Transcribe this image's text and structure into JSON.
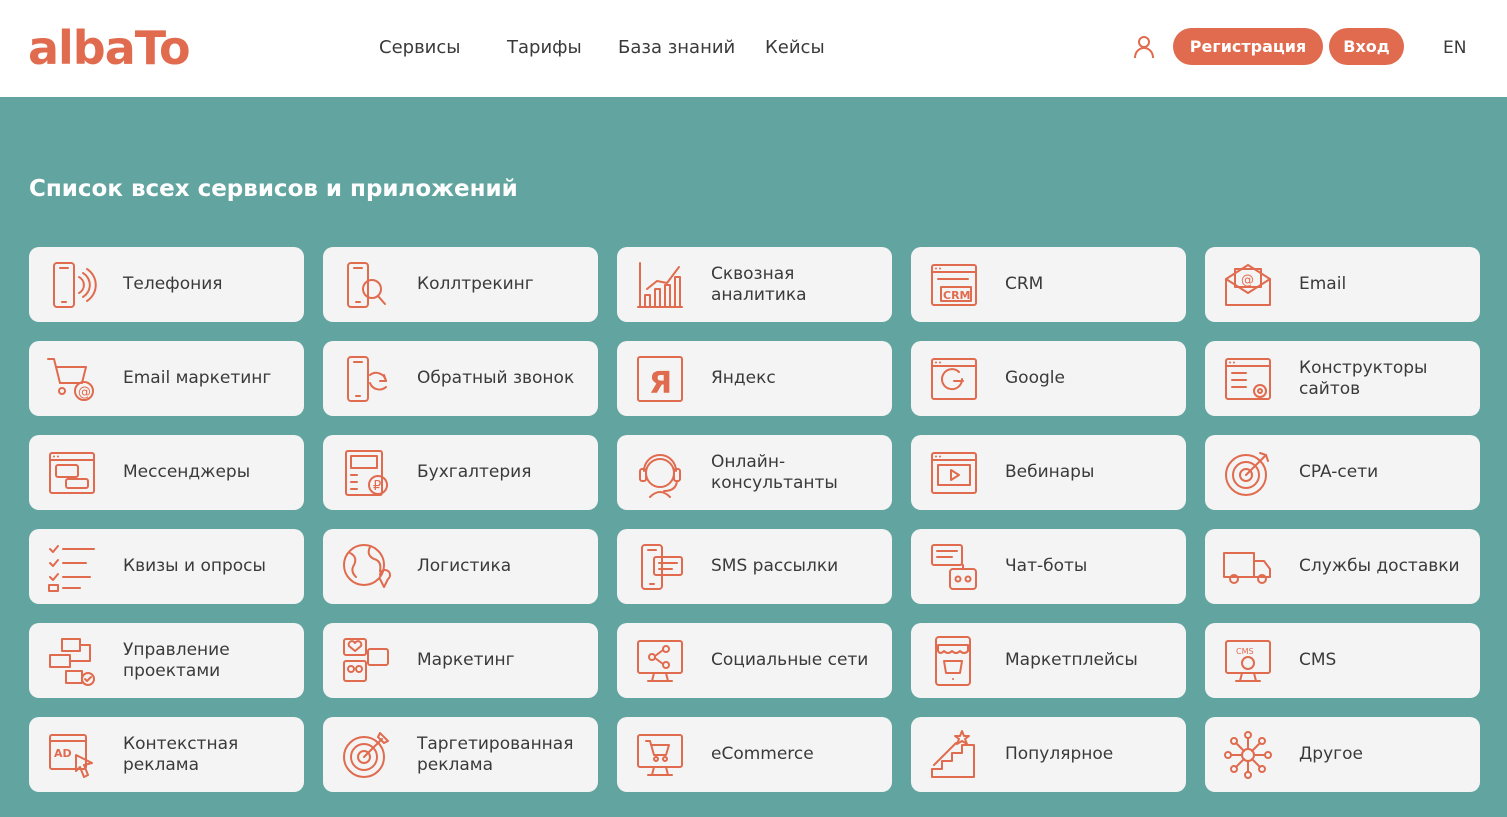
{
  "header": {
    "logo": "albaTo",
    "nav": [
      "Сервисы",
      "Тарифы",
      "База знаний",
      "Кейсы"
    ],
    "register_label": "Регистрация",
    "login_label": "Вход",
    "lang": "EN"
  },
  "colors": {
    "accent": "#e06b4e",
    "background": "#62a49f",
    "card": "#f4f4f4"
  },
  "main": {
    "title": "Список всех сервисов и приложений",
    "categories": [
      {
        "label": "Телефония",
        "icon": "phone-ringing-icon"
      },
      {
        "label": "Коллтрекинг",
        "icon": "phone-search-icon"
      },
      {
        "label": "Сквозная аналитика",
        "icon": "analytics-chart-icon"
      },
      {
        "label": "CRM",
        "icon": "crm-window-icon"
      },
      {
        "label": "Email",
        "icon": "email-envelope-icon"
      },
      {
        "label": "Email маркетинг",
        "icon": "cart-email-icon"
      },
      {
        "label": "Обратный звонок",
        "icon": "phone-callback-icon"
      },
      {
        "label": "Яндекс",
        "icon": "yandex-icon"
      },
      {
        "label": "Google",
        "icon": "google-window-icon"
      },
      {
        "label": "Конструкторы сайтов",
        "icon": "site-builder-icon"
      },
      {
        "label": "Мессенджеры",
        "icon": "messenger-window-icon"
      },
      {
        "label": "Бухгалтерия",
        "icon": "calculator-ruble-icon"
      },
      {
        "label": "Онлайн-консультанты",
        "icon": "headset-operator-icon"
      },
      {
        "label": "Вебинары",
        "icon": "video-window-icon"
      },
      {
        "label": "CPA-сети",
        "icon": "target-arrow-icon"
      },
      {
        "label": "Квизы и опросы",
        "icon": "checklist-icon"
      },
      {
        "label": "Логистика",
        "icon": "globe-pin-icon"
      },
      {
        "label": "SMS рассылки",
        "icon": "phone-sms-icon"
      },
      {
        "label": "Чат-боты",
        "icon": "chatbot-icon"
      },
      {
        "label": "Службы доставки",
        "icon": "delivery-truck-icon"
      },
      {
        "label": "Управление проектами",
        "icon": "project-flow-icon"
      },
      {
        "label": "Маркетинг",
        "icon": "social-likes-icon"
      },
      {
        "label": "Социальные сети",
        "icon": "monitor-share-icon"
      },
      {
        "label": "Маркетплейсы",
        "icon": "marketplace-phone-icon"
      },
      {
        "label": "CMS",
        "icon": "cms-monitor-icon"
      },
      {
        "label": "Контекстная реклама",
        "icon": "ad-cursor-icon"
      },
      {
        "label": "Таргетированная реклама",
        "icon": "target-dart-icon"
      },
      {
        "label": "eCommerce",
        "icon": "monitor-cart-icon"
      },
      {
        "label": "Популярное",
        "icon": "star-stairs-icon"
      },
      {
        "label": "Другое",
        "icon": "network-nodes-icon"
      }
    ]
  }
}
